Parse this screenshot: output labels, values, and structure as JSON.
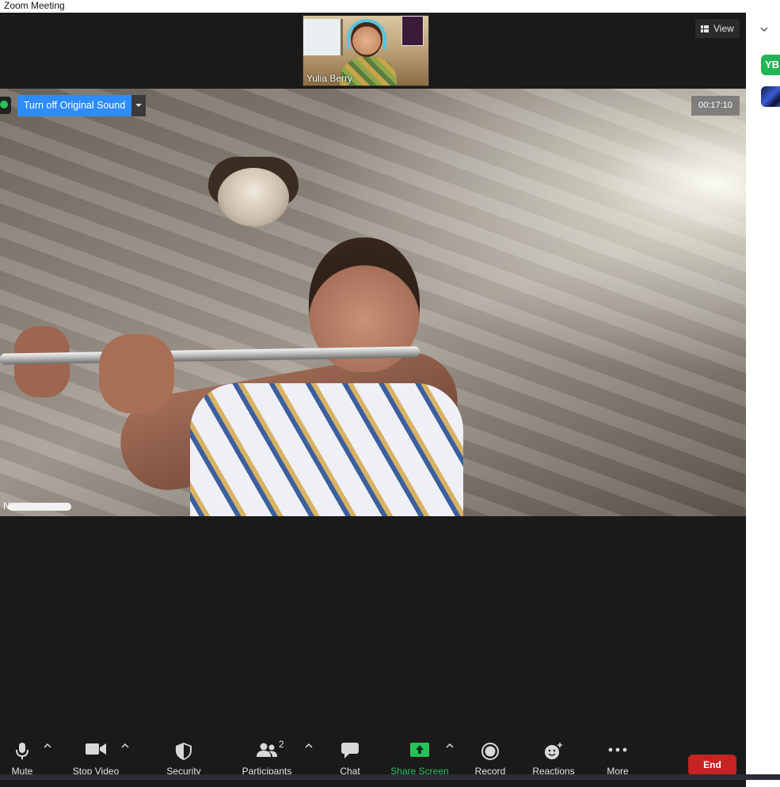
{
  "window": {
    "title": "Zoom Meeting"
  },
  "view_button": {
    "label": "View",
    "icon": "grid-icon"
  },
  "thumbnail": {
    "name": "Yulia Berry"
  },
  "sidebar": {
    "avatar_initials": "YB"
  },
  "main_video": {
    "original_sound_button": "Turn off Original Sound",
    "timer": "00:17:10",
    "participant_name_visible": "N"
  },
  "toolbar": {
    "mute": "Mute",
    "stop_video": "Stop Video",
    "security": "Security",
    "participants": "Participants",
    "participants_count": "2",
    "chat": "Chat",
    "share_screen": "Share Screen",
    "record": "Record",
    "reactions": "Reactions",
    "more": "More",
    "end": "End"
  },
  "colors": {
    "accent_blue": "#2d8cff",
    "share_green": "#25c259",
    "end_red": "#c62323",
    "avatar_green": "#22b455"
  }
}
